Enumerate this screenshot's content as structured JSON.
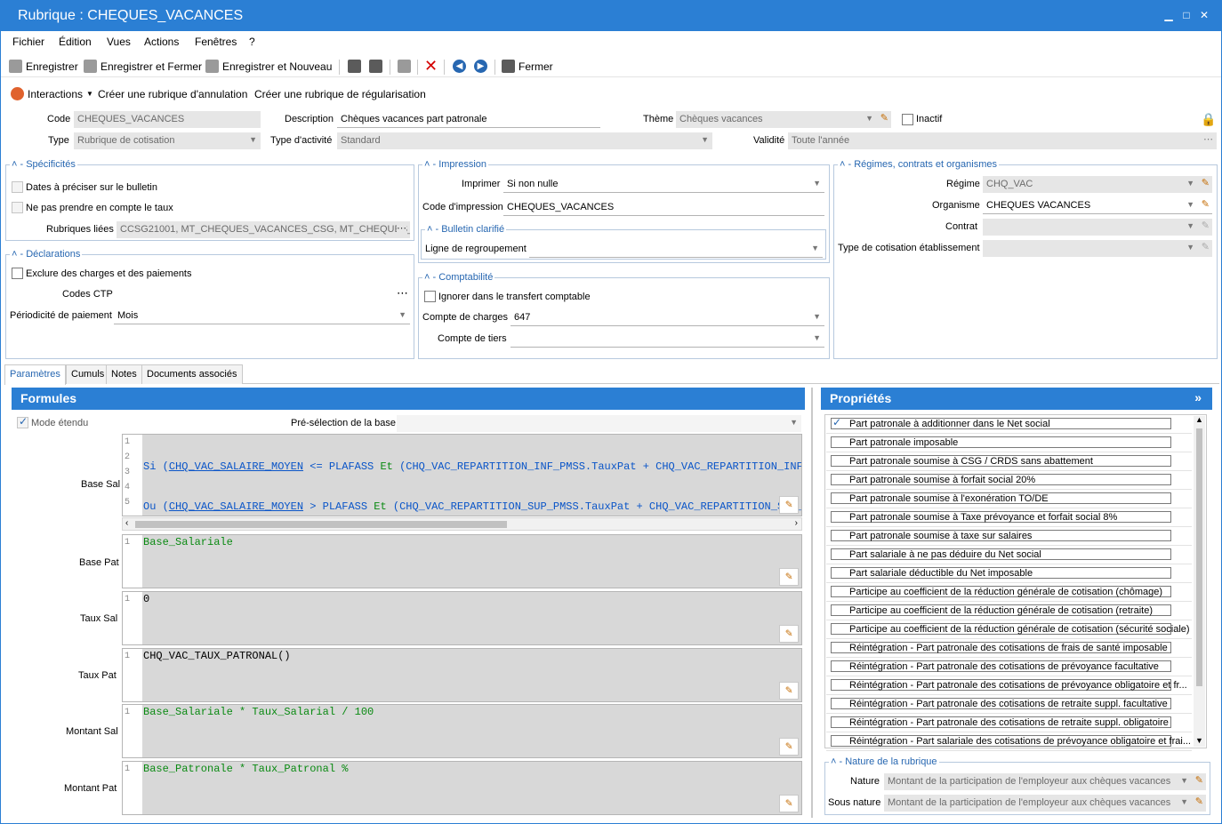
{
  "window": {
    "title": "Rubrique : CHEQUES_VACANCES"
  },
  "menu": [
    "Fichier",
    "Édition",
    "Vues",
    "Actions",
    "Fenêtres",
    "?"
  ],
  "toolbar": {
    "save": "Enregistrer",
    "save_close": "Enregistrer et Fermer",
    "save_new": "Enregistrer et Nouveau",
    "close": "Fermer"
  },
  "actions": {
    "interactions": "Interactions",
    "cancel_rubric": "Créer une rubrique d'annulation",
    "regul_rubric": "Créer une rubrique de régularisation"
  },
  "header": {
    "code_label": "Code",
    "code_value": "CHEQUES_VACANCES",
    "description_label": "Description",
    "description_value": "Chèques vacances part patronale",
    "theme_label": "Thème",
    "theme_value": "Chèques vacances",
    "inactive_label": "Inactif",
    "type_label": "Type",
    "type_value": "Rubrique de cotisation",
    "activity_label": "Type d'activité",
    "activity_value": "Standard",
    "validity_label": "Validité",
    "validity_value": "Toute l'année"
  },
  "specificites": {
    "title": "Spécificités",
    "dates_label": "Dates à préciser sur le bulletin",
    "taux_label": "Ne pas prendre en compte le taux",
    "linked_label": "Rubriques liées",
    "linked_value": "CCSG21001, MT_CHEQUES_VACANCES_CSG, MT_CHEQUES_VA"
  },
  "declarations": {
    "title": "Déclarations",
    "exclude_label": "Exclure des charges et des paiements",
    "ctp_label": "Codes CTP",
    "periodicity_label": "Périodicité de paiement",
    "periodicity_value": "Mois"
  },
  "impression": {
    "title": "Impression",
    "print_label": "Imprimer",
    "print_value": "Si non nulle",
    "code_label": "Code d'impression",
    "code_value": "CHEQUES_VACANCES",
    "clarified_title": "Bulletin clarifié",
    "group_label": "Ligne de regroupement",
    "group_value": ""
  },
  "comptabilite": {
    "title": "Comptabilité",
    "ignore_label": "Ignorer dans le transfert comptable",
    "charges_label": "Compte de charges",
    "charges_value": "647",
    "tiers_label": "Compte de tiers",
    "tiers_value": ""
  },
  "regimes": {
    "title": "Régimes, contrats et organismes",
    "regime_label": "Régime",
    "regime_value": "CHQ_VAC",
    "org_label": "Organisme",
    "org_value": "CHEQUES VACANCES",
    "contract_label": "Contrat",
    "contract_value": "",
    "cotis_label": "Type de cotisation établissement",
    "cotis_value": ""
  },
  "tabs": [
    "Paramètres",
    "Cumuls",
    "Notes",
    "Documents associés"
  ],
  "formules": {
    "title": "Formules",
    "extended_label": "Mode étendu",
    "preselect_label": "Pré-sélection de la base",
    "base_sal_label": "Base Sal",
    "base_pat_label": "Base Pat",
    "taux_sal_label": "Taux Sal",
    "taux_pat_label": "Taux Pat",
    "montant_sal_label": "Montant Sal",
    "montant_pat_label": "Montant Pat",
    "base_pat_code": "Base_Salariale",
    "taux_sal_code": "0",
    "taux_pat_code": "CHQ_VAC_TAUX_PATRONAL()",
    "montant_sal_code": "Base_Salariale * Taux_Salarial / 100",
    "montant_pat_code": "Base_Patronale * Taux_Patronal %"
  },
  "proprietes": {
    "title": "Propriétés",
    "items": [
      "Part patronale à additionner dans le Net social",
      "Part patronale imposable",
      "Part patronale soumise à CSG / CRDS sans abattement",
      "Part patronale soumise à forfait social 20%",
      "Part patronale soumise à l'exonération TO/DE",
      "Part patronale soumise à Taxe prévoyance et forfait social 8%",
      "Part patronale soumise à taxe sur salaires",
      "Part salariale à ne pas déduire du Net social",
      "Part salariale déductible du Net imposable",
      "Participe au coefficient de la réduction générale de cotisation (chômage)",
      "Participe au coefficient de la réduction générale de cotisation (retraite)",
      "Participe au coefficient de la réduction générale de cotisation (sécurité sociale)",
      "Réintégration - Part patronale des cotisations de frais de santé imposable",
      "Réintégration - Part patronale des cotisations de prévoyance facultative",
      "Réintégration - Part patronale des cotisations de prévoyance obligatoire et fr...",
      "Réintégration - Part patronale des cotisations de retraite suppl. facultative",
      "Réintégration - Part patronale des cotisations de retraite suppl. obligatoire",
      "Réintégration - Part salariale des cotisations de prévoyance obligatoire et frai..."
    ],
    "nature_title": "Nature de la rubrique",
    "nature_label": "Nature",
    "nature_value": "Montant de la participation de l'employeur aux chèques vacances",
    "subnature_label": "Sous nature",
    "subnature_value": "Montant de la participation de l'employeur aux chèques vacances"
  }
}
